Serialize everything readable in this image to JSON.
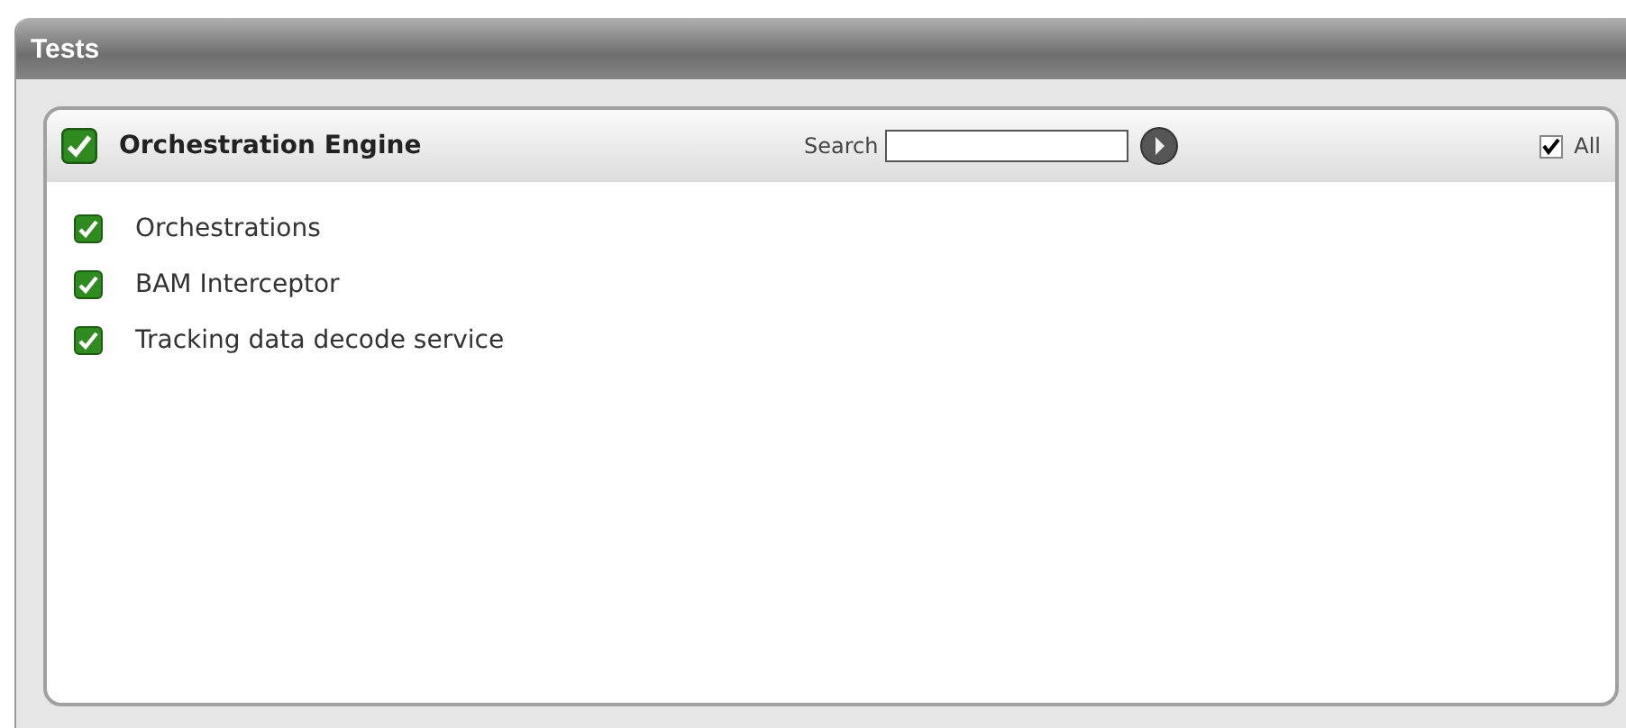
{
  "window": {
    "title": "Tests"
  },
  "group": {
    "title": "Orchestration Engine",
    "checked": true,
    "search": {
      "label": "Search"
    },
    "all": {
      "label": "All",
      "checked": true
    }
  },
  "items": [
    {
      "label": "Orchestrations",
      "checked": true
    },
    {
      "label": "BAM Interceptor",
      "checked": true
    },
    {
      "label": "Tracking data decode service",
      "checked": true
    }
  ]
}
